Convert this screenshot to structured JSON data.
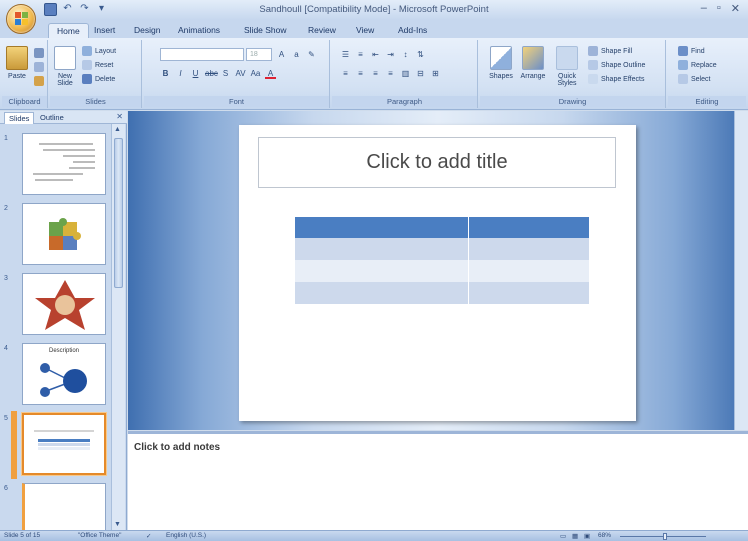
{
  "window": {
    "title": "Sandhoull [Compatibility Mode] - Microsoft PowerPoint",
    "controls": [
      "–",
      "▫",
      "✕"
    ]
  },
  "quick_access": {
    "undo": "↶",
    "redo": "↷",
    "more": "▾"
  },
  "tabs": [
    {
      "label": "Home",
      "active": true
    },
    {
      "label": "Insert",
      "active": false
    },
    {
      "label": "Design",
      "active": false
    },
    {
      "label": "Animations",
      "active": false
    },
    {
      "label": "Slide Show",
      "active": false
    },
    {
      "label": "Review",
      "active": false
    },
    {
      "label": "View",
      "active": false
    },
    {
      "label": "Add-Ins",
      "active": false
    }
  ],
  "ribbon": {
    "clipboard": {
      "label": "Clipboard",
      "paste": "Paste"
    },
    "slides": {
      "label": "Slides",
      "new_slide": "New Slide",
      "layout": "Layout",
      "reset": "Reset",
      "delete": "Delete"
    },
    "font": {
      "label": "Font",
      "font_name": "",
      "font_size": "18"
    },
    "paragraph": {
      "label": "Paragraph"
    },
    "drawing": {
      "label": "Drawing",
      "shapes": "Shapes",
      "arrange": "Arrange",
      "quick_styles": "Quick Styles",
      "shape_fill": "Shape Fill",
      "shape_outline": "Shape Outline",
      "shape_effects": "Shape Effects"
    },
    "editing": {
      "label": "Editing",
      "find": "Find",
      "replace": "Replace",
      "select": "Select"
    }
  },
  "left_pane": {
    "tab_slides": "Slides",
    "tab_outline": "Outline",
    "close": "✕",
    "thumbnails": [
      {
        "number": "1",
        "selected": false
      },
      {
        "number": "2",
        "selected": false
      },
      {
        "number": "3",
        "selected": false
      },
      {
        "number": "4",
        "selected": false
      },
      {
        "number": "5",
        "selected": true
      },
      {
        "number": "6",
        "selected": false
      }
    ],
    "thumb4_heading": "Description"
  },
  "slide": {
    "title_placeholder": "Click to add title",
    "table": {
      "columns": 2,
      "rows": 4,
      "header_color": "#4a7ec2",
      "band_color": "#cdd9ec",
      "alt_color": "#e8eef7"
    }
  },
  "notes": {
    "placeholder": "Click to add notes"
  },
  "status_bar": {
    "slide_indicator": "Slide 5 of 15",
    "theme": "\"Office Theme\"",
    "language": "English (U.S.)",
    "zoom": "68%"
  }
}
